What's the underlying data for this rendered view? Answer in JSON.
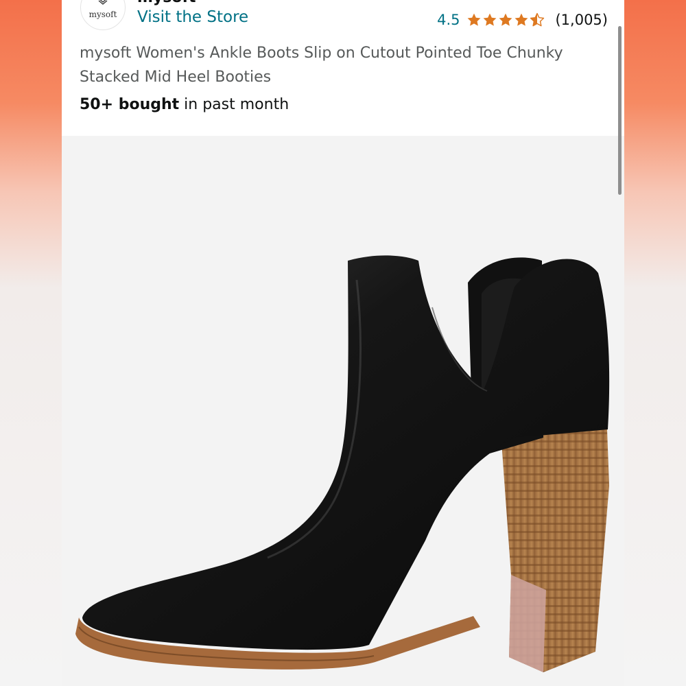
{
  "store": {
    "brand_name": "mysoft",
    "logo_text": "mysoft",
    "visit_store_label": "Visit the Store"
  },
  "rating": {
    "value": "4.5",
    "stars": 4.5,
    "count": "(1,005)",
    "star_color": "#de7921"
  },
  "product": {
    "title": "mysoft Women's Ankle Boots Slip on Cutout Pointed Toe Chunky Stacked Mid Heel Booties",
    "bought_bold": "50+ bought",
    "bought_rest": " in past month"
  },
  "image": {
    "icon": "product-image-ankle-boot"
  },
  "colors": {
    "link": "#007185",
    "text": "#0f1111",
    "muted": "#565959",
    "accent_bg": "#f3704a"
  }
}
